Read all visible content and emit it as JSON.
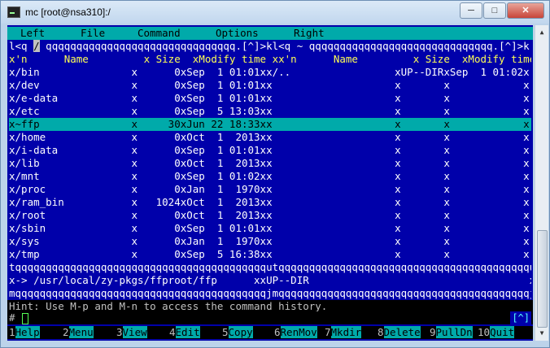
{
  "window": {
    "title": "mc [root@nsa310]:/",
    "minimize": "─",
    "maximize": "□",
    "close": "✕"
  },
  "menu": [
    "Left",
    "File",
    "Command",
    "Options",
    "Right"
  ],
  "lines": {
    "top_border_left": "l<q ",
    "path_tag": "/",
    "top_border_left_rest": " qqqqqqqqqqqqqqqqqqqqqqqqqqqqqqq.[^]>kl<q ~ qqqqqqqqqqqqqqqqqqqqqqqqqqqqqq.[^]>k",
    "header": "x'n      Name         x Size  xModify time xx'n      Name         x Size  xModify time x",
    "rows": [
      "x/bin               x      0xSep  1 01:01xx/..                 xUP--DIRxSep  1 01:02x",
      "x/dev               x      0xSep  1 01:01xx                    x       x            x",
      "x/e-data            x      0xSep  1 01:01xx                    x       x            x",
      "x/etc               x      0xSep  5 13:03xx                    x       x            x",
      "x~ffp               x     30xJun 22 18:33xx                    x       x            x",
      "x/home              x      0xOct  1  2013xx                    x       x            x",
      "x/i-data            x      0xSep  1 01:01xx                    x       x            x",
      "x/lib               x      0xOct  1  2013xx                    x       x            x",
      "x/mnt               x      0xSep  1 01:02xx                    x       x            x",
      "x/proc              x      0xJan  1  1970xx                    x       x            x",
      "x/ram_bin           x   1024xOct  1  2013xx                    x       x            x",
      "x/root              x      0xOct  1  2013xx                    x       x            x",
      "x/sbin              x      0xSep  1 01:01xx                    x       x            x",
      "x/sys               x      0xJan  1  1970xx                    x       x            x",
      "x/tmp               x      0xSep  5 16:38xx                    x       x            x"
    ],
    "separator": "tqqqqqqqqqqqqqqqqqqqqqqqqqqqqqqqqqqqqqqqqqutqqqqqqqqqqqqqqqqqqqqqqqqqqqqqqqqqqqqqqqqqu",
    "info": "x-> /usr/local/zy-pkgs/ffproot/ffp      xxUP--DIR                                    x",
    "bottom_border": "mqqqqqqqqqqqqqqqqqqqqqqqqqqqqqqqqqqqqqqqqqjmqqqqqqqqqqqqqqqqqqqqqqqqqqqqqqqqqqqqqqqqqj",
    "hint": "Hint: Use M-p and M-n to access the command history."
  },
  "cmdline": {
    "prompt": "#",
    "history_btn": "[^]"
  },
  "fkeys": [
    {
      "num": "1",
      "label": "Help"
    },
    {
      "num": "2",
      "label": "Menu"
    },
    {
      "num": "3",
      "label": "View"
    },
    {
      "num": "4",
      "label": "Edit"
    },
    {
      "num": "5",
      "label": "Copy"
    },
    {
      "num": "6",
      "label": "RenMov"
    },
    {
      "num": "7",
      "label": "Mkdir"
    },
    {
      "num": "8",
      "label": "Delete"
    },
    {
      "num": "9",
      "label": "PullDn"
    },
    {
      "num": "10",
      "label": "Quit"
    }
  ]
}
